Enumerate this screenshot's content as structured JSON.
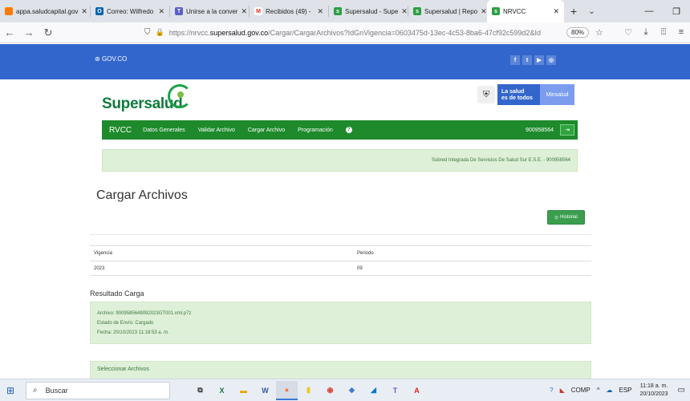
{
  "browser": {
    "tabs": [
      {
        "label": "appa.saludcapital.gov",
        "icon": "globe-icon",
        "color": "#ff7a00"
      },
      {
        "label": "Correo: Wilfredo",
        "icon": "outlook-icon",
        "color": "#0a64ad"
      },
      {
        "label": "Unirse a la conver",
        "icon": "teams-icon",
        "color": "#5b5fc7"
      },
      {
        "label": "Recibidos (49) -",
        "icon": "gmail-icon",
        "color": "#d93025"
      },
      {
        "label": "Supersalud - Supe",
        "icon": "supersalud-icon",
        "color": "#2e9e44"
      },
      {
        "label": "Supersalud | Repo",
        "icon": "supersalud-icon",
        "color": "#2e9e44"
      },
      {
        "label": "NRVCC",
        "icon": "supersalud-icon",
        "color": "#2e9e44"
      }
    ],
    "new_tab": "+",
    "list_tabs": "⌄",
    "window_controls": [
      "—",
      "❐",
      "✕"
    ],
    "url_host": "https://nrvcc.",
    "url_domain": "supersalud.gov.co",
    "url_path": "/Cargar/CargarArchivos?IdGnVigencia=0603475d-13ec-4c53-8ba6-47cf92c599d2&Id",
    "zoom": "80%"
  },
  "page": {
    "gov_logo": "GOV.CO",
    "social": [
      "f",
      "t",
      "▶",
      "◎"
    ],
    "brand": "Supersalud",
    "lasalud_line1": "La salud",
    "lasalud_line2": "es de todos",
    "minsalud": "Minsalud",
    "nav": {
      "app": "RVCC",
      "items": [
        "Datos Generales",
        "Validar Archivo",
        "Cargar Archivo",
        "Programación"
      ],
      "help": "?",
      "nit": "900958564",
      "logout": "⇥"
    },
    "entity": "Subred Integrada De Servicios De Salud Sur E.S.E. - 900958564",
    "title": "Cargar Archivos",
    "historial_button": "Historial",
    "table": {
      "headers": [
        "Vigencia",
        "Periodo"
      ],
      "row": [
        "2023",
        "09"
      ]
    },
    "result_title": "Resultado Carga",
    "result_lines": [
      "Archivo: 9009585649092023GT001.xml.p7z",
      "Estado de Envío: Cargado",
      "Fecha: 20/10/2023 11:18:53 a. m."
    ],
    "select_files": "Seleccionar Archivos"
  },
  "taskbar": {
    "search_placeholder": "Buscar",
    "lang": "ESP",
    "time": "11:18 a. m.",
    "date": "20/10/2023",
    "comp": "COMP"
  }
}
